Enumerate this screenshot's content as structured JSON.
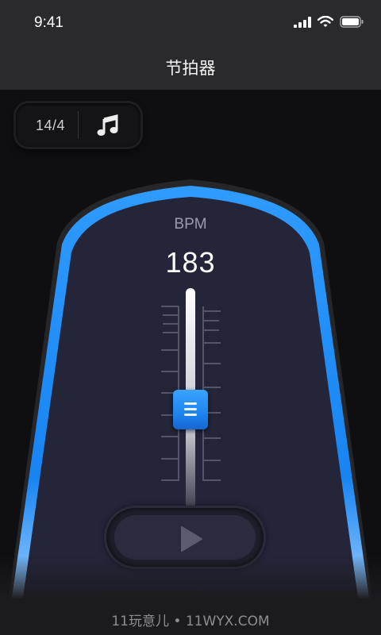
{
  "status_bar": {
    "time": "9:41",
    "icons": [
      "signal-icon",
      "wifi-icon",
      "battery-icon"
    ]
  },
  "nav": {
    "title": "节拍器"
  },
  "meter": {
    "time_signature": "14/4",
    "sound_icon": "music-note-icon"
  },
  "tempo": {
    "label": "BPM",
    "value": "183",
    "slider_level": 0.55
  },
  "controls": {
    "play_icon": "play-icon"
  },
  "watermark": "11玩意儿 • 11WYX.COM",
  "colors": {
    "accent": "#1e88f5",
    "background": "#0f0f11",
    "panel": "#25253a",
    "bar": "#2a2a2c"
  }
}
